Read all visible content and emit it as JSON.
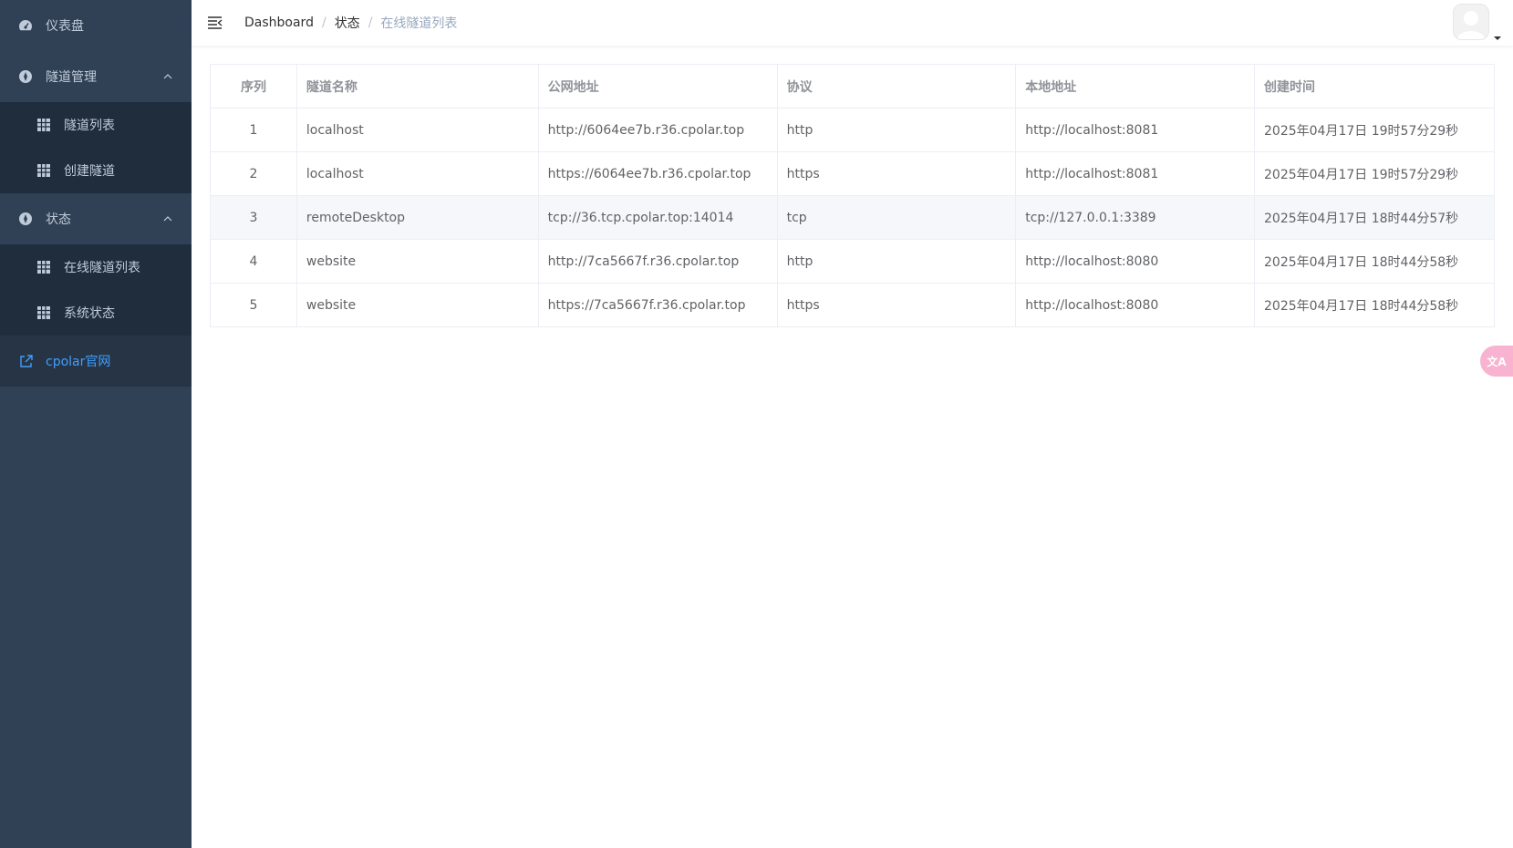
{
  "sidebar": {
    "dashboard": "仪表盘",
    "tunnel_mgmt": "隧道管理",
    "tunnel_list": "隧道列表",
    "create_tunnel": "创建隧道",
    "status": "状态",
    "online_tunnels": "在线隧道列表",
    "system_status": "系统状态",
    "cpolar_site": "cpolar官网"
  },
  "breadcrumb": {
    "home": "Dashboard",
    "sep1": "/",
    "level2": "状态",
    "sep2": "/",
    "current": "在线隧道列表"
  },
  "table": {
    "headers": [
      "序列",
      "隧道名称",
      "公网地址",
      "协议",
      "本地地址",
      "创建时间"
    ],
    "rows": [
      [
        "1",
        "localhost",
        "http://6064ee7b.r36.cpolar.top",
        "http",
        "http://localhost:8081",
        "2025年04月17日 19时57分29秒"
      ],
      [
        "2",
        "localhost",
        "https://6064ee7b.r36.cpolar.top",
        "https",
        "http://localhost:8081",
        "2025年04月17日 19时57分29秒"
      ],
      [
        "3",
        "remoteDesktop",
        "tcp://36.tcp.cpolar.top:14014",
        "tcp",
        "tcp://127.0.0.1:3389",
        "2025年04月17日 18时44分57秒"
      ],
      [
        "4",
        "website",
        "http://7ca5667f.r36.cpolar.top",
        "http",
        "http://localhost:8080",
        "2025年04月17日 18时44分58秒"
      ],
      [
        "5",
        "website",
        "https://7ca5667f.r36.cpolar.top",
        "https",
        "http://localhost:8080",
        "2025年04月17日 18时44分58秒"
      ]
    ]
  },
  "translate_button": "文A",
  "colors": {
    "sidebar_bg": "#304156",
    "submenu_bg": "#1f2d3d",
    "link": "#409eff"
  }
}
